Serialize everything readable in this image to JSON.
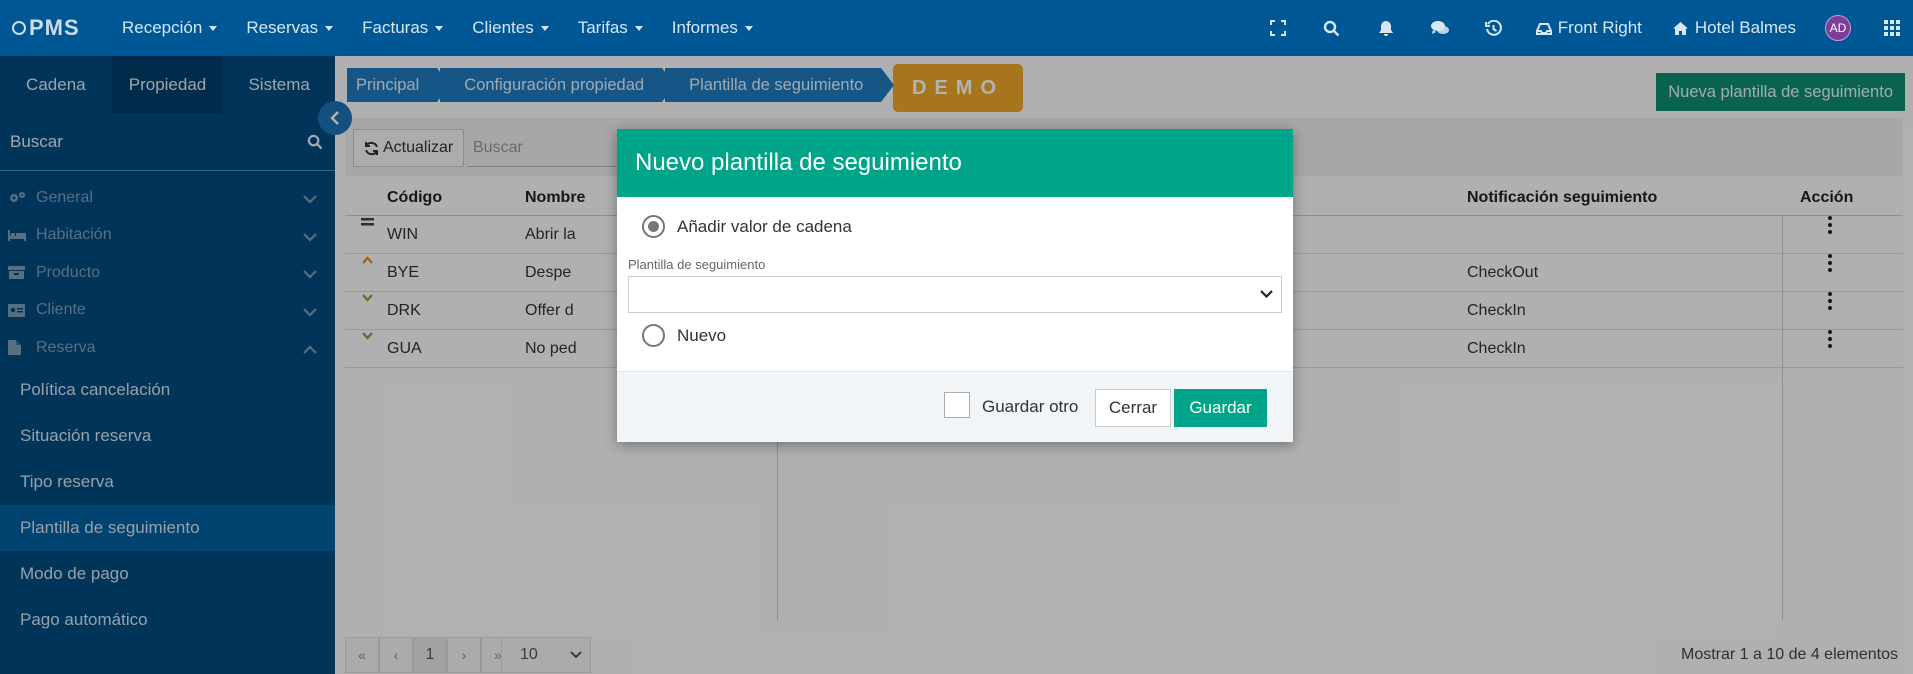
{
  "app": {
    "logo_text": "PMS"
  },
  "nav": {
    "menu": [
      {
        "label": "Recepción"
      },
      {
        "label": "Reservas"
      },
      {
        "label": "Facturas"
      },
      {
        "label": "Clientes"
      },
      {
        "label": "Tarifas"
      },
      {
        "label": "Informes"
      }
    ],
    "device_label": "Front Right",
    "hotel_label": "Hotel Balmes",
    "avatar_initials": "AD"
  },
  "sidebar": {
    "tabs": [
      {
        "label": "Cadena"
      },
      {
        "label": "Propiedad",
        "active": true
      },
      {
        "label": "Sistema"
      }
    ],
    "search_placeholder": "Buscar",
    "sections": [
      {
        "label": "General",
        "icon": "gears-icon"
      },
      {
        "label": "Habitación",
        "icon": "bed-icon"
      },
      {
        "label": "Producto",
        "icon": "box-icon"
      },
      {
        "label": "Cliente",
        "icon": "id-card-icon"
      },
      {
        "label": "Reserva",
        "icon": "document-icon",
        "expanded": true
      }
    ],
    "reserva_items": [
      {
        "label": "Política cancelación"
      },
      {
        "label": "Situación reserva"
      },
      {
        "label": "Tipo reserva"
      },
      {
        "label": "Plantilla de seguimiento",
        "active": true
      },
      {
        "label": "Modo de pago"
      },
      {
        "label": "Pago automático"
      }
    ]
  },
  "breadcrumb": [
    {
      "label": "Principal"
    },
    {
      "label": "Configuración propiedad"
    },
    {
      "label": "Plantilla de seguimiento"
    }
  ],
  "demo_badge": "DEMO",
  "new_button": "Nueva plantilla de seguimiento",
  "toolbar": {
    "refresh_label": "Actualizar",
    "search_placeholder": "Buscar"
  },
  "table": {
    "columns": {
      "code": "Código",
      "name": "Nombre",
      "notification": "Notificación seguimiento",
      "action": "Acción"
    },
    "rows": [
      {
        "priority": "equal",
        "code": "WIN",
        "name": "Abrir la",
        "notification": ""
      },
      {
        "priority": "up",
        "code": "BYE",
        "name": "Despe",
        "notification": "CheckOut"
      },
      {
        "priority": "down",
        "code": "DRK",
        "name": "Offer d",
        "notification": "CheckIn"
      },
      {
        "priority": "down",
        "code": "GUA",
        "name": "No ped",
        "notification": "CheckIn"
      }
    ]
  },
  "pager": {
    "first": "«",
    "prev": "‹",
    "current": "1",
    "next": "›",
    "last": "»",
    "page_size": "10"
  },
  "record_count": "Mostrar 1 a 10 de 4 elementos",
  "modal": {
    "title": "Nuevo plantilla de seguimiento",
    "option_chain": "Añadir valor de cadena",
    "field_label": "Plantilla de seguimiento",
    "field_value": "",
    "option_new": "Nuevo",
    "save_another": "Guardar otro",
    "close_label": "Cerrar",
    "save_label": "Guardar"
  },
  "colors": {
    "nav_bg": "#005795",
    "sidebar_bg": "#004b7f",
    "modal_header": "#00a589",
    "demo_badge": "#f0a829",
    "new_button": "#0f8f72"
  }
}
